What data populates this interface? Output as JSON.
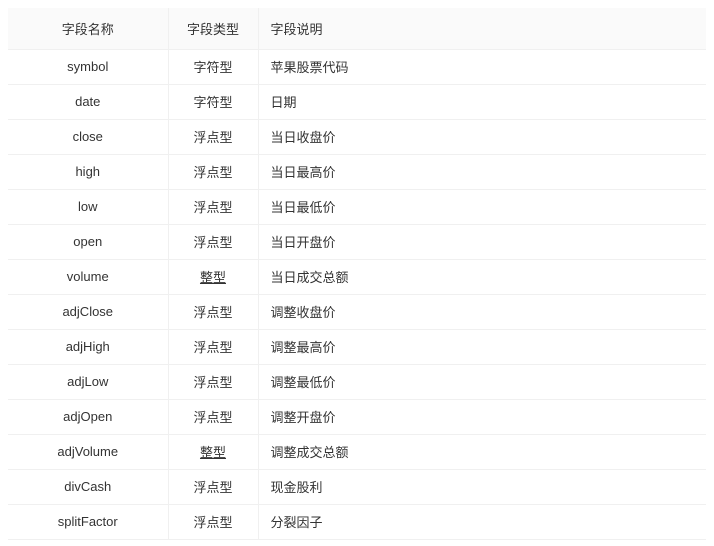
{
  "table": {
    "headers": [
      "字段名称",
      "字段类型",
      "字段说明"
    ],
    "rows": [
      {
        "name": "symbol",
        "type": "字符型",
        "type_underline": false,
        "desc": "苹果股票代码"
      },
      {
        "name": "date",
        "type": "字符型",
        "type_underline": false,
        "desc": "日期"
      },
      {
        "name": "close",
        "type": "浮点型",
        "type_underline": false,
        "desc": "当日收盘价"
      },
      {
        "name": "high",
        "type": "浮点型",
        "type_underline": false,
        "desc": "当日最高价"
      },
      {
        "name": "low",
        "type": "浮点型",
        "type_underline": false,
        "desc": "当日最低价"
      },
      {
        "name": "open",
        "type": "浮点型",
        "type_underline": false,
        "desc": "当日开盘价"
      },
      {
        "name": "volume",
        "type": "整型",
        "type_underline": true,
        "desc": "当日成交总额"
      },
      {
        "name": "adjClose",
        "type": "浮点型",
        "type_underline": false,
        "desc": "调整收盘价"
      },
      {
        "name": "adjHigh",
        "type": "浮点型",
        "type_underline": false,
        "desc": "调整最高价"
      },
      {
        "name": "adjLow",
        "type": "浮点型",
        "type_underline": false,
        "desc": "调整最低价"
      },
      {
        "name": "adjOpen",
        "type": "浮点型",
        "type_underline": false,
        "desc": "调整开盘价"
      },
      {
        "name": "adjVolume",
        "type": "整型",
        "type_underline": true,
        "desc": "调整成交总额"
      },
      {
        "name": "divCash",
        "type": "浮点型",
        "type_underline": false,
        "desc": "现金股利"
      },
      {
        "name": "splitFactor",
        "type": "浮点型",
        "type_underline": false,
        "desc": "分裂因子"
      }
    ]
  },
  "colors": {
    "header_bg": "#fafafa",
    "border": "#f0f0f0",
    "text": "#333333",
    "page_bg": "#ffffff"
  }
}
